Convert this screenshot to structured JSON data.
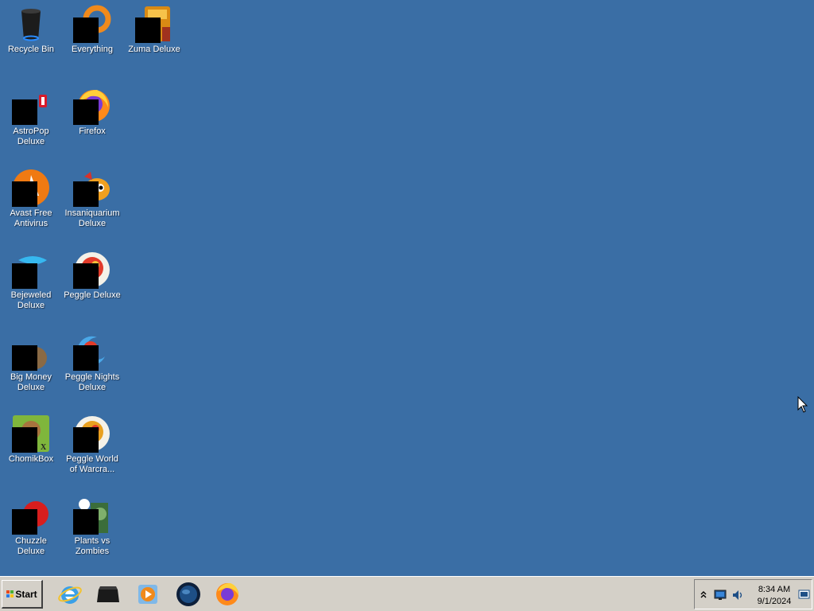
{
  "desktop": {
    "icons": [
      {
        "label": "Recycle Bin",
        "icon": "recycle-bin-icon"
      },
      {
        "label": "Everything",
        "icon": "everything-search-icon"
      },
      {
        "label": "Zuma Deluxe",
        "icon": "zuma-deluxe-icon"
      },
      {
        "label": "AstroPop Deluxe",
        "icon": "astropop-icon"
      },
      {
        "label": "Firefox",
        "icon": "firefox-icon"
      },
      {
        "label": "Avast Free Antivirus",
        "icon": "avast-icon"
      },
      {
        "label": "Insaniquarium Deluxe",
        "icon": "insaniquarium-icon"
      },
      {
        "label": "Bejeweled Deluxe",
        "icon": "bejeweled-icon"
      },
      {
        "label": "Peggle Deluxe",
        "icon": "peggle-icon"
      },
      {
        "label": "Big Money Deluxe",
        "icon": "big-money-icon"
      },
      {
        "label": "Peggle Nights Deluxe",
        "icon": "peggle-nights-icon"
      },
      {
        "label": "ChomikBox",
        "icon": "chomikbox-icon"
      },
      {
        "label": "Peggle World of Warcra...",
        "icon": "peggle-warcraft-icon"
      },
      {
        "label": "Chuzzle Deluxe",
        "icon": "chuzzle-icon"
      },
      {
        "label": "Plants vs Zombies",
        "icon": "plants-vs-zombies-icon"
      }
    ]
  },
  "taskbar": {
    "start_label": "Start",
    "pinned": [
      {
        "icon": "internet-explorer-icon"
      },
      {
        "icon": "terminal-icon"
      },
      {
        "icon": "media-player-icon"
      },
      {
        "icon": "globe-icon"
      },
      {
        "icon": "firefox-icon"
      }
    ],
    "tray": {
      "time": "8:34 AM",
      "date": "9/1/2024",
      "icons": [
        "show-hidden-icons-chevron",
        "network-icon",
        "volume-icon",
        "action-center-icon"
      ]
    }
  },
  "colors": {
    "desktop_background": "#3a6ea5",
    "taskbar_background": "#d4d0c8"
  }
}
